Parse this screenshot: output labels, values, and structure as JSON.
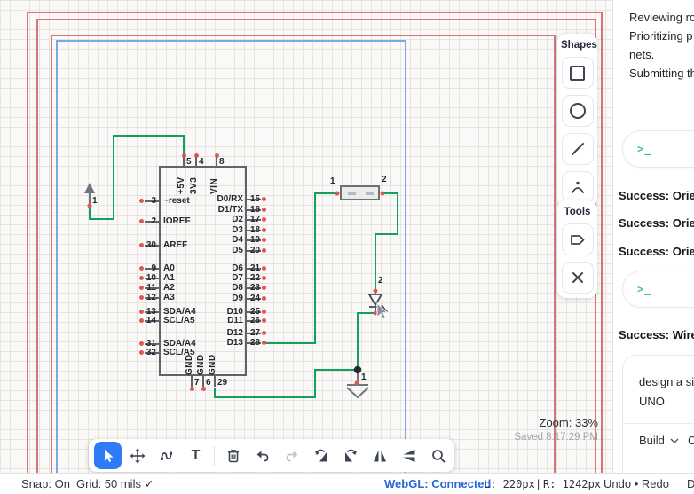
{
  "canvas": {
    "zoom_label": "Zoom: 33%",
    "saved_label": "Saved 8:17:29 PM",
    "chip": {
      "top_pins": [
        {
          "num": "5",
          "name": "+5V"
        },
        {
          "num": "4",
          "name": "3V3"
        },
        {
          "num": "8",
          "name": "VIN"
        }
      ],
      "left_pins": [
        {
          "num": "3",
          "name": "~reset"
        },
        {
          "num": "2",
          "name": "IOREF"
        },
        {
          "num": "30",
          "name": "AREF"
        },
        {
          "num": "9",
          "name": "A0"
        },
        {
          "num": "10",
          "name": "A1"
        },
        {
          "num": "11",
          "name": "A2"
        },
        {
          "num": "12",
          "name": "A3"
        },
        {
          "num": "13",
          "name": "SDA/A4"
        },
        {
          "num": "14",
          "name": "SCL/A5"
        },
        {
          "num": "31",
          "name": "SDA/A4"
        },
        {
          "num": "32",
          "name": "SCL/A5"
        }
      ],
      "right_pins": [
        {
          "name": "D0/RX",
          "num": "15"
        },
        {
          "name": "D1/TX",
          "num": "16"
        },
        {
          "name": "D2",
          "num": "17"
        },
        {
          "name": "D3",
          "num": "18"
        },
        {
          "name": "D4",
          "num": "19"
        },
        {
          "name": "D5",
          "num": "20"
        },
        {
          "name": "D6",
          "num": "21"
        },
        {
          "name": "D7",
          "num": "22"
        },
        {
          "name": "D8",
          "num": "23"
        },
        {
          "name": "D9",
          "num": "24"
        },
        {
          "name": "D10",
          "num": "25"
        },
        {
          "name": "D11",
          "num": "26"
        },
        {
          "name": "D12",
          "num": "27"
        },
        {
          "name": "D13",
          "num": "28"
        }
      ],
      "bottom_pins": [
        {
          "num": "7",
          "name": "GND"
        },
        {
          "num": "6",
          "name": "GND"
        },
        {
          "num": "29",
          "name": "GND"
        }
      ]
    },
    "resistor": {
      "pin1": "1",
      "pin2": "2"
    },
    "led": {
      "pin": "2"
    },
    "power_port": {
      "pin": "1"
    },
    "ground": {
      "pin": "1"
    }
  },
  "shapes_panel": {
    "title": "Shapes"
  },
  "tools_panel": {
    "title": "Tools"
  },
  "toolbar": {
    "text_tool_glyph": "T"
  },
  "sidebar": {
    "log_lines": [
      "Reviewing ro",
      "Prioritizing p",
      "nets.",
      "Submitting th"
    ],
    "prompt_icon": ">_",
    "success_lines": [
      "Success: Orien",
      "Success: Orien",
      "Success: Orien"
    ],
    "success_wire": "Success: Wire",
    "prompt_card": {
      "line1": "design a sim",
      "line2": "UNO",
      "build_label": "Build",
      "extra": "C"
    }
  },
  "statusbar": {
    "snap": "Snap: On",
    "grid": "Grid: 50 mils ✓",
    "webgl": "WebGL: Connected",
    "left_px": "L: 220px",
    "sep": "|",
    "right_px": "R: 1242px",
    "undo_redo": "Undo • Redo",
    "overflow": "D"
  }
}
